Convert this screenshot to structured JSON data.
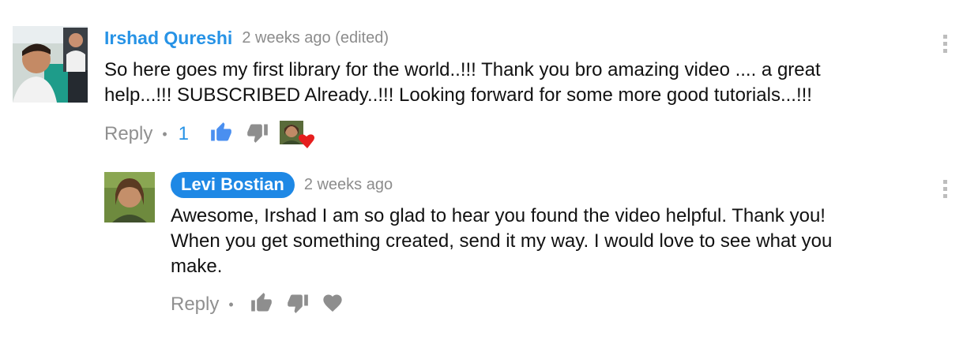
{
  "comments": [
    {
      "author": "Irshad Qureshi",
      "time": "2 weeks ago (edited)",
      "body_lines": [
        "So here goes my first library for the world..!!! Thank you bro amazing video .... a great",
        "help...!!!  SUBSCRIBED Already..!!! Looking forward for some more good tutorials...!!!"
      ],
      "reply_label": "Reply",
      "separator": "•",
      "like_count": "1",
      "like_icon": "thumbs-up-icon",
      "dislike_icon": "thumbs-down-icon",
      "creator_heart": "creator-heart-avatar",
      "menu_icon": "more-vert-icon"
    },
    {
      "author": "Levi Bostian",
      "time": "2 weeks ago",
      "body_lines": [
        "Awesome, Irshad I am so glad to hear you found the video helpful. Thank you!",
        "When you get something created, send it my way. I would love to see what you",
        "make."
      ],
      "reply_label": "Reply",
      "separator": "•",
      "like_icon": "thumbs-up-icon",
      "dislike_icon": "thumbs-down-icon",
      "heart_icon": "heart-icon",
      "menu_icon": "more-vert-icon"
    }
  ],
  "colors": {
    "author_link": "#2793e6",
    "creator_pill": "#1e88e5",
    "like_active": "#4a8ff0",
    "muted_icon": "#8e8e8e",
    "heart": "#e61e1e"
  }
}
